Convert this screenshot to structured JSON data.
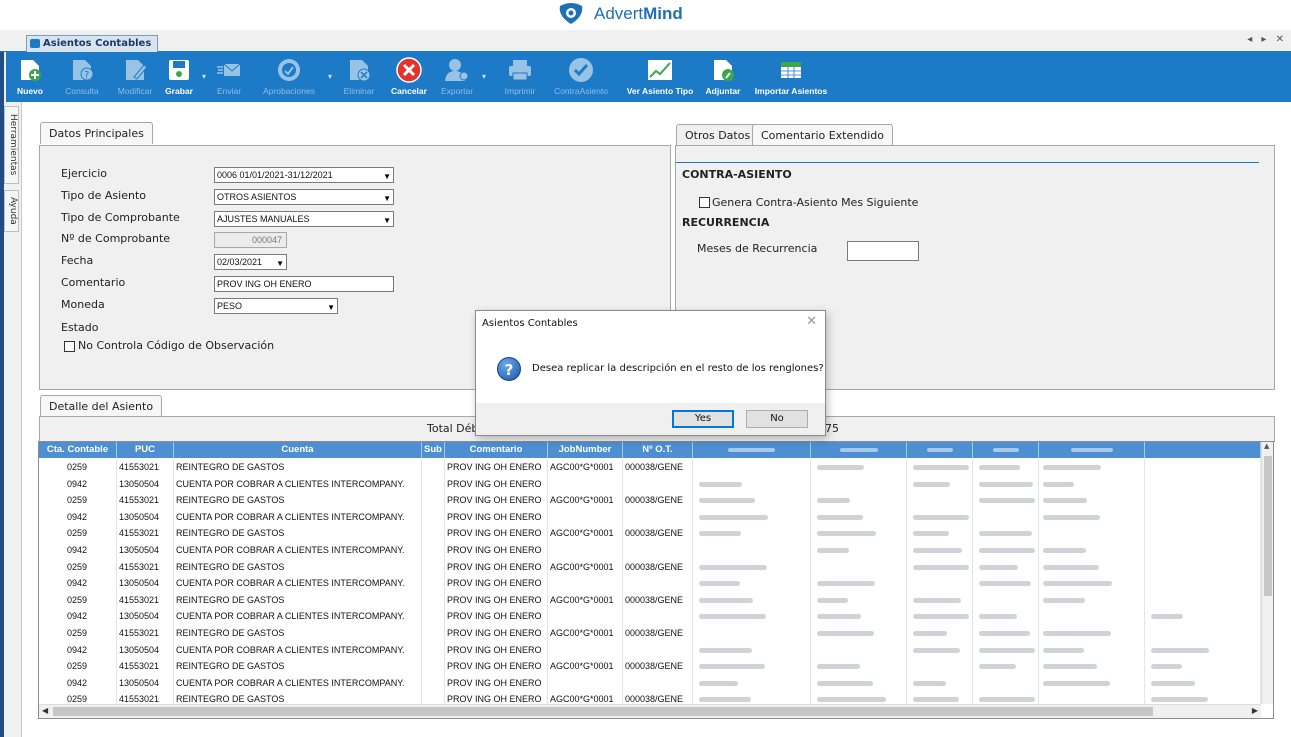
{
  "brand": {
    "name_prefix": "Advert",
    "name_bold": "Mind"
  },
  "tab": {
    "title": "Asientos Contables",
    "controls": "◂ ▸ ✕"
  },
  "left_tabs": [
    "Herramientas",
    "Ayuda"
  ],
  "toolbar": [
    {
      "label": "Nuevo",
      "icon": "new-doc-icon",
      "enabled": true
    },
    {
      "label": "Consulta",
      "icon": "query-doc-icon",
      "enabled": false
    },
    {
      "label": "Modificar",
      "icon": "edit-doc-icon",
      "enabled": false
    },
    {
      "label": "Grabar",
      "icon": "save-icon",
      "enabled": true
    },
    {
      "label": "Enviar",
      "icon": "send-icon",
      "enabled": false
    },
    {
      "label": "Aprobaciones",
      "icon": "approvals-icon",
      "enabled": false
    },
    {
      "label": "Eliminar",
      "icon": "delete-doc-icon",
      "enabled": false
    },
    {
      "label": "Cancelar",
      "icon": "cancel-icon",
      "enabled": true
    },
    {
      "label": "Exportar",
      "icon": "export-user-icon",
      "enabled": false
    },
    {
      "label": "Imprimir",
      "icon": "printer-icon",
      "enabled": false
    },
    {
      "label": "ContraAsiento",
      "icon": "check-icon",
      "enabled": false
    },
    {
      "label": "Ver Asiento Tipo",
      "icon": "chart-icon",
      "enabled": true
    },
    {
      "label": "Adjuntar",
      "icon": "attach-icon",
      "enabled": true
    },
    {
      "label": "Importar Asientos",
      "icon": "excel-icon",
      "enabled": true
    }
  ],
  "datos_principales": {
    "tab_label": "Datos Principales",
    "ejercicio_label": "Ejercicio",
    "ejercicio_value": "0006 01/01/2021-31/12/2021",
    "tipo_asiento_label": "Tipo de Asiento",
    "tipo_asiento_value": "OTROS ASIENTOS",
    "tipo_comprobante_label": "Tipo de Comprobante",
    "tipo_comprobante_value": "AJUSTES MANUALES",
    "nro_comprobante_label": "Nº de Comprobante",
    "nro_comprobante_value": "000047",
    "fecha_label": "Fecha",
    "fecha_value": "02/03/2021",
    "comentario_label": "Comentario",
    "comentario_value": "PROV ING OH ENERO",
    "moneda_label": "Moneda",
    "moneda_value": "PESO",
    "estado_label": "Estado",
    "no_controla_label": "No Controla Código de Observación"
  },
  "otros_datos": {
    "tab1": "Otros Datos",
    "tab2": "Comentario Extendido",
    "contra_title": "CONTRA-ASIENTO",
    "genera_label": "Genera Contra-Asiento Mes Siguiente",
    "recurrencia_title": "RECURRENCIA",
    "meses_label": "Meses de Recurrencia",
    "meses_value": ""
  },
  "detalle": {
    "tab_label": "Detalle del Asiento",
    "total_label": "Total Déb",
    "total_suffix": "75",
    "columns": [
      "Cta. Contable",
      "PUC",
      "Cuenta",
      "Sub",
      "Comentario",
      "JobNumber",
      "Nº O.T."
    ],
    "rows": [
      {
        "cta": "0259",
        "puc": "41553021",
        "cuenta": "REINTEGRO DE GASTOS",
        "comentario": "PROV ING OH ENERO",
        "job": "AGC00*G*0001",
        "ot": "000038/GENE"
      },
      {
        "cta": "0942",
        "puc": "13050504",
        "cuenta": "CUENTA POR COBRAR A CLIENTES INTERCOMPANY.",
        "comentario": "PROV ING OH ENERO",
        "job": "",
        "ot": ""
      },
      {
        "cta": "0259",
        "puc": "41553021",
        "cuenta": "REINTEGRO DE GASTOS",
        "comentario": "PROV ING OH ENERO",
        "job": "AGC00*G*0001",
        "ot": "000038/GENE"
      },
      {
        "cta": "0942",
        "puc": "13050504",
        "cuenta": "CUENTA POR COBRAR A CLIENTES INTERCOMPANY.",
        "comentario": "PROV ING OH ENERO",
        "job": "",
        "ot": ""
      },
      {
        "cta": "0259",
        "puc": "41553021",
        "cuenta": "REINTEGRO DE GASTOS",
        "comentario": "PROV ING OH ENERO",
        "job": "AGC00*G*0001",
        "ot": "000038/GENE"
      },
      {
        "cta": "0942",
        "puc": "13050504",
        "cuenta": "CUENTA POR COBRAR A CLIENTES INTERCOMPANY.",
        "comentario": "PROV ING OH ENERO",
        "job": "",
        "ot": ""
      },
      {
        "cta": "0259",
        "puc": "41553021",
        "cuenta": "REINTEGRO DE GASTOS",
        "comentario": "PROV ING OH ENERO",
        "job": "AGC00*G*0001",
        "ot": "000038/GENE"
      },
      {
        "cta": "0942",
        "puc": "13050504",
        "cuenta": "CUENTA POR COBRAR A CLIENTES INTERCOMPANY.",
        "comentario": "PROV ING OH ENERO",
        "job": "",
        "ot": ""
      },
      {
        "cta": "0259",
        "puc": "41553021",
        "cuenta": "REINTEGRO DE GASTOS",
        "comentario": "PROV ING OH ENERO",
        "job": "AGC00*G*0001",
        "ot": "000038/GENE"
      },
      {
        "cta": "0942",
        "puc": "13050504",
        "cuenta": "CUENTA POR COBRAR A CLIENTES INTERCOMPANY.",
        "comentario": "PROV ING OH ENERO",
        "job": "",
        "ot": ""
      },
      {
        "cta": "0259",
        "puc": "41553021",
        "cuenta": "REINTEGRO DE GASTOS",
        "comentario": "PROV ING OH ENERO",
        "job": "AGC00*G*0001",
        "ot": "000038/GENE"
      },
      {
        "cta": "0942",
        "puc": "13050504",
        "cuenta": "CUENTA POR COBRAR A CLIENTES INTERCOMPANY.",
        "comentario": "PROV ING OH ENERO",
        "job": "",
        "ot": ""
      },
      {
        "cta": "0259",
        "puc": "41553021",
        "cuenta": "REINTEGRO DE GASTOS",
        "comentario": "PROV ING OH ENERO",
        "job": "AGC00*G*0001",
        "ot": "000038/GENE"
      },
      {
        "cta": "0942",
        "puc": "13050504",
        "cuenta": "CUENTA POR COBRAR A CLIENTES INTERCOMPANY.",
        "comentario": "PROV ING OH ENERO",
        "job": "",
        "ot": ""
      },
      {
        "cta": "0259",
        "puc": "41553021",
        "cuenta": "REINTEGRO DE GASTOS",
        "comentario": "PROV ING OH ENERO",
        "job": "AGC00*G*0001",
        "ot": "000038/GENE"
      }
    ]
  },
  "dialog": {
    "title": "Asientos Contables",
    "close": "✕",
    "message": "Desea replicar la descripción en el resto de los renglones?",
    "yes": "Yes",
    "no": "No"
  },
  "colors": {
    "toolbar": "#1c7ac6",
    "grid_header": "#4d8fd0",
    "brand": "#1f6fb6"
  }
}
